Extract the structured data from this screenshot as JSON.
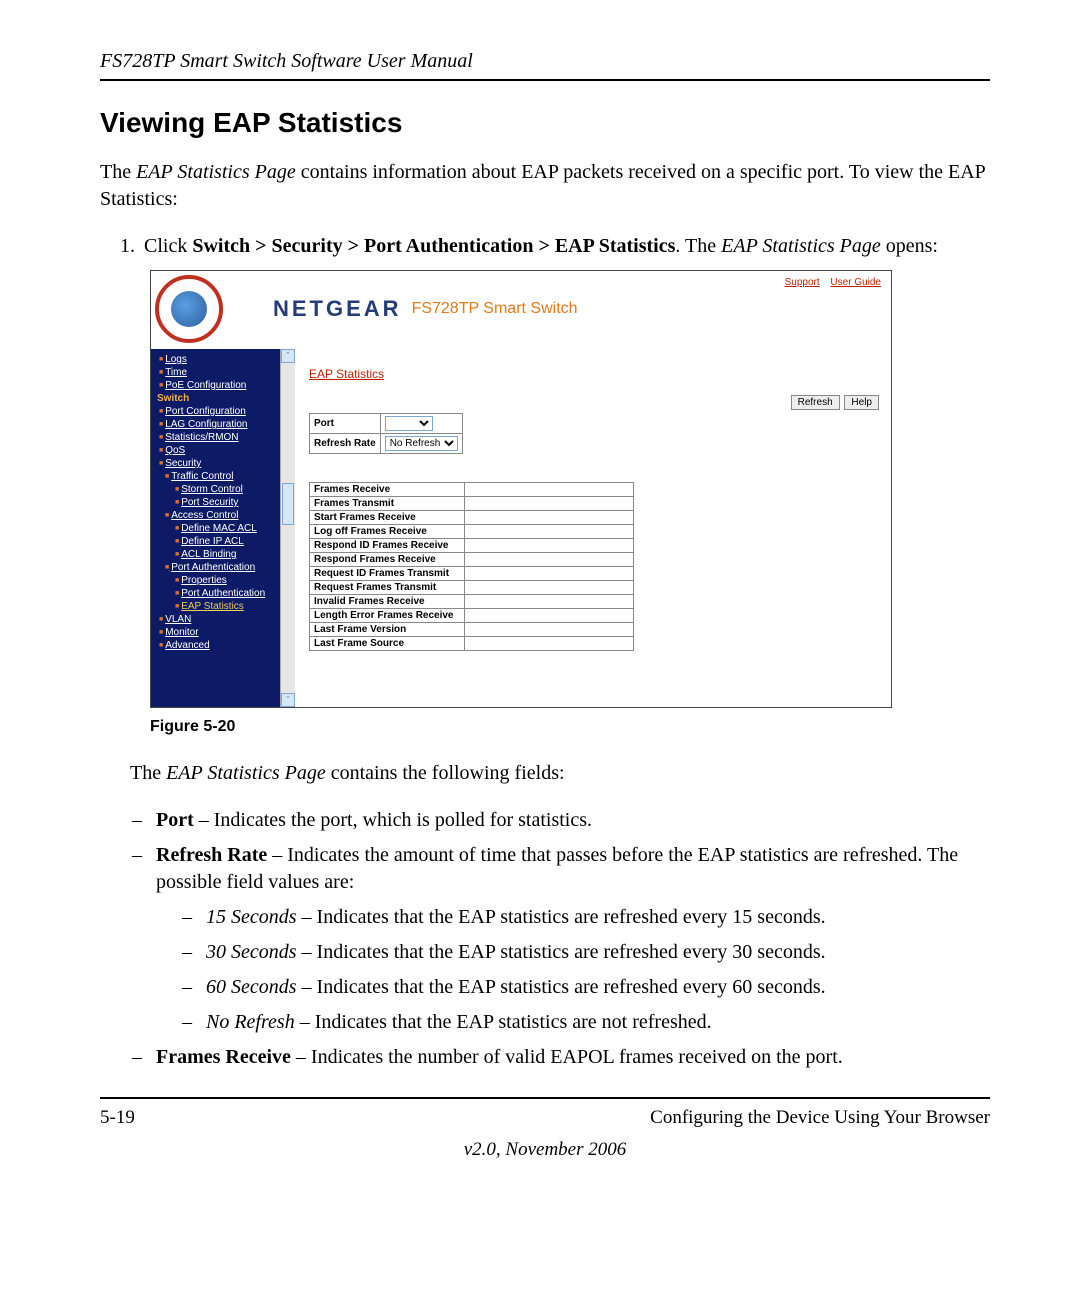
{
  "header_title": "FS728TP Smart Switch Software User Manual",
  "section_title": "Viewing EAP Statistics",
  "intro_a": "The ",
  "intro_em": "EAP Statistics Page",
  "intro_b": " contains information about EAP packets received on a specific port. To view the EAP Statistics:",
  "step1_a": "Click ",
  "step1_bold": "Switch > Security > Port Authentication > EAP Statistics",
  "step1_b": ". The ",
  "step1_em": "EAP Statistics Page",
  "step1_c": " opens:",
  "figure_caption": "Figure 5-20",
  "fields_intro_a": "The ",
  "fields_intro_em": "EAP Statistics Page",
  "fields_intro_b": " contains the following fields:",
  "field_port_bold": "Port",
  "field_port_text": " – Indicates the port, which is polled for statistics.",
  "field_rr_bold": "Refresh Rate",
  "field_rr_text": " – Indicates the amount of time that passes before the EAP statistics are refreshed. The possible field values are:",
  "rr_15_em": "15 Seconds",
  "rr_15_text": " – Indicates that the EAP statistics are refreshed every 15 seconds.",
  "rr_30_em": "30 Seconds",
  "rr_30_text": " – Indicates that the EAP statistics are refreshed every 30 seconds.",
  "rr_60_em": "60 Seconds",
  "rr_60_text": " – Indicates that the EAP statistics are refreshed every 60 seconds.",
  "rr_no_em": "No Refresh",
  "rr_no_text": " – Indicates that the EAP statistics are not refreshed.",
  "field_fr_bold": "Frames Receive",
  "field_fr_text": " – Indicates the number of valid EAPOL frames received on the port.",
  "footer_left": "5-19",
  "footer_right": "Configuring the Device Using Your Browser",
  "footer_center": "v2.0, November 2006",
  "shot": {
    "brand": "NETGEAR",
    "model": "FS728TP Smart Switch",
    "support": "Support",
    "userguide": "User Guide",
    "content_title": "EAP Statistics",
    "btn_refresh": "Refresh",
    "btn_help": "Help",
    "form_port": "Port",
    "form_rr": "Refresh Rate",
    "form_rr_value": "No Refresh",
    "stats": [
      "Frames Receive",
      "Frames Transmit",
      "Start Frames Receive",
      "Log off Frames Receive",
      "Respond ID Frames Receive",
      "Respond Frames Receive",
      "Request ID Frames Transmit",
      "Request Frames Transmit",
      "Invalid Frames Receive",
      "Length Error Frames Receive",
      "Last Frame Version",
      "Last Frame Source"
    ],
    "sidebar": {
      "logs": "Logs",
      "time": "Time",
      "poe": "PoE Configuration",
      "switch": "Switch",
      "portconf": "Port Configuration",
      "lag": "LAG Configuration",
      "stats": "Statistics/RMON",
      "qos": "QoS",
      "security": "Security",
      "traffic": "Traffic Control",
      "storm": "Storm Control",
      "portsec": "Port Security",
      "access": "Access Control",
      "defmac": "Define MAC ACL",
      "defip": "Define IP ACL",
      "aclbind": "ACL Binding",
      "portauth": "Port Authentication",
      "props": "Properties",
      "portauth2": "Port Authentication",
      "eap": "EAP Statistics",
      "vlan": "VLAN",
      "monitor": "Monitor",
      "advanced": "Advanced"
    }
  }
}
